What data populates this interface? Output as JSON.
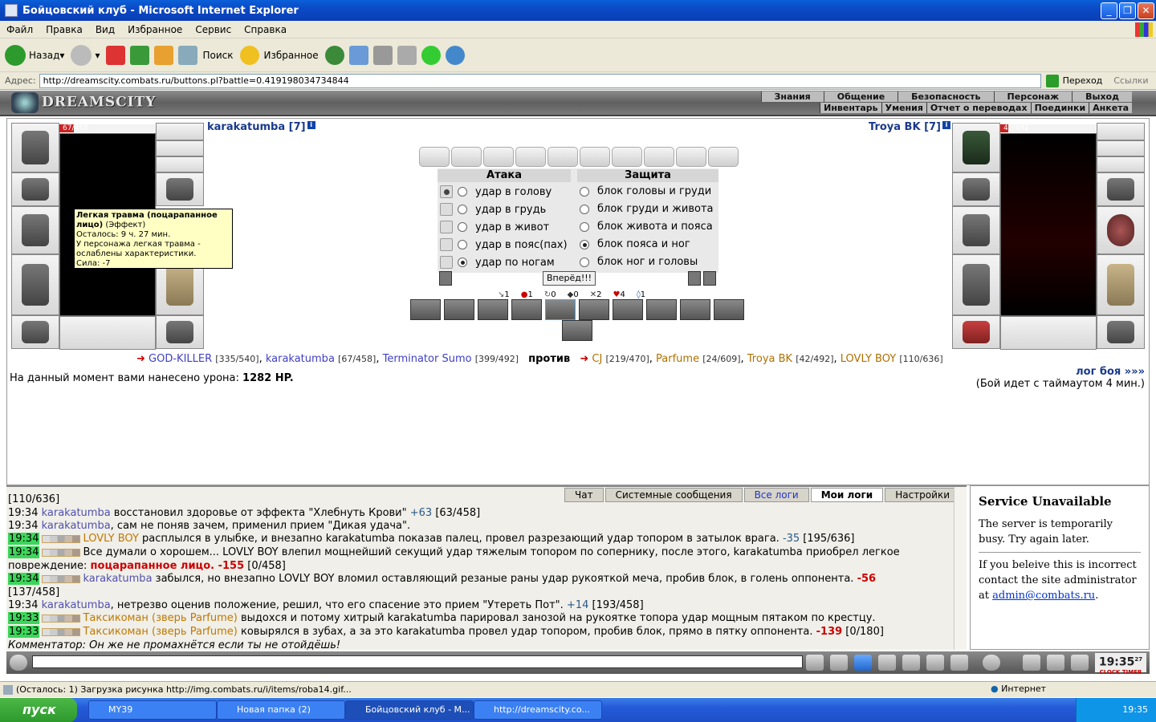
{
  "window": {
    "title": "Бойцовский клуб - Microsoft Internet Explorer"
  },
  "menu": [
    "Файл",
    "Правка",
    "Вид",
    "Избранное",
    "Сервис",
    "Справка"
  ],
  "toolbar": {
    "back": "Назад",
    "search": "Поиск",
    "favorites": "Избранное"
  },
  "address": {
    "label": "Адрес:",
    "url": "http://dreamscity.combats.ru/buttons.pl?battle=0.419198034734844",
    "go": "Переход",
    "links": "Ссылки"
  },
  "site": {
    "logo": "DREAMSCITY",
    "nav_top": [
      "Знания",
      "Общение",
      "Безопасность",
      "Персонаж",
      "Выход"
    ],
    "nav_bottom": [
      "Инвентарь",
      "Умения",
      "Отчет о переводах",
      "Поединки",
      "Анкета"
    ]
  },
  "player_left": {
    "name": "karakatumba [7]",
    "hp": "67/458",
    "hp_fraction": 0.146
  },
  "player_right": {
    "name": "Troya BK [7]",
    "hp": "42/492",
    "hp_fraction": 0.085
  },
  "tooltip": {
    "title": "Легкая травма (поцарапанное лицо)",
    "kind": "(Эффект)",
    "line1": "Осталось: 9 ч. 27 мин.",
    "line2": "У персонажа легкая травма - ослаблены характеристики.",
    "line3": "Сила: -7"
  },
  "attack": {
    "header": "Атака",
    "options": [
      "удар в голову",
      "удар в грудь",
      "удар в живот",
      "удар в пояс(пах)",
      "удар по ногам"
    ]
  },
  "defense": {
    "header": "Защита",
    "options": [
      "блок головы и груди",
      "блок груди и живота",
      "блок живота и пояса",
      "блок пояса и ног",
      "блок ног и головы"
    ]
  },
  "go_button": "Вперёд!!!",
  "stats": [
    "1",
    "1",
    "0",
    "0",
    "2",
    "4",
    "1"
  ],
  "teams": {
    "left": [
      {
        "name": "GOD-KILLER",
        "hp": "[335/540]"
      },
      {
        "name": "karakatumba",
        "hp": "[67/458]"
      },
      {
        "name": "Terminator Sumo",
        "hp": "[399/492]"
      }
    ],
    "vs": "против",
    "right": [
      {
        "name": "CJ",
        "hp": "[219/470]"
      },
      {
        "name": "Parfume",
        "hp": "[24/609]"
      },
      {
        "name": "Troya BK",
        "hp": "[42/492]"
      },
      {
        "name": "LOVLY BOY",
        "hp": "[110/636]"
      }
    ]
  },
  "damage": {
    "label": "На данный момент вами нанесено урона:",
    "value": "1282 HP."
  },
  "battle_log": {
    "link": "лог боя »»»",
    "timeout": "(Бой идет с таймаутом 4 мин.)"
  },
  "chat_tabs": [
    "Чат",
    "Системные сообщения",
    "Все логи",
    "Мои логи",
    "Настройки"
  ],
  "chat": [
    {
      "time": "",
      "text": "[110/636]"
    },
    {
      "time": "19:34",
      "who": "karakatumba",
      "text": " восстановил здоровье от эффекта \"Хлебнуть Крови\" ",
      "val": "+63",
      "tail": " [63/458]"
    },
    {
      "time": "19:34",
      "who": "karakatumba",
      "text": ", сам не поняв зачем, применил прием \"Дикая удача\"."
    },
    {
      "time": "19:34",
      "who": "LOVLY BOY",
      "text": " расплылся в улыбке, и внезапно karakatumba показав палец, провел разрезающий удар топором в затылок врага. ",
      "val": "-35",
      "tail": " [195/636]"
    },
    {
      "time": "19:34",
      "text": "Все думали о хорошем... LOVLY BOY влепил мощнейший секущий удар тяжелым топором по сопернику, после этого, karakatumba приобрел легкое"
    },
    {
      "time": "",
      "text": "повреждение: ",
      "val": "поцарапанное лицо. -155",
      "tail": " [0/458]"
    },
    {
      "time": "19:34",
      "who": "karakatumba",
      "text": " забылся, но внезапно LOVLY BOY вломил оставляющий резаные раны удар рукояткой меча, пробив блок, в голень оппонента. ",
      "val": "-56"
    },
    {
      "time": "",
      "text": "[137/458]"
    },
    {
      "time": "19:34",
      "who": "karakatumba",
      "text": ", нетрезво оценив положение, решил, что его спасение это прием \"Утереть Пот\". ",
      "val": "+14",
      "tail": " [193/458]"
    },
    {
      "time": "19:33",
      "who": "Таксикоман (зверь Parfume)",
      "text": " выдохся и потому хитрый karakatumba парировал занозой на рукоятке топора удар мощным пятаком по крестцу."
    },
    {
      "time": "19:33",
      "who": "Таксикоман (зверь Parfume)",
      "text": " ковырялся в зубах, а за это karakatumba провел удар топором, пробив блок, прямо в пятку оппонента. ",
      "val": "-139",
      "tail": " [0/180]"
    },
    {
      "time": "",
      "text": "Комментатор: Он же не промахнётся если ты не отойдёшь!"
    }
  ],
  "service": {
    "title": "Service Unavailable",
    "p1": "The server is temporarily busy. Try again later.",
    "p2": "If you beleive this is incorrect contact the site administrator at",
    "email": "admin@combats.ru",
    "dot": "."
  },
  "clock": {
    "time": "19:35",
    "sec": "27",
    "label1": "CLOCK",
    "label2": "TIMER"
  },
  "status": {
    "text": "(Осталось: 1) Загрузка рисунка http://img.combats.ru/i/items/roba14.gif...",
    "zone": "Интернет"
  },
  "taskbar": {
    "start": "пуск",
    "tasks": [
      "MY39",
      "Новая папка (2)",
      "Бойцовский клуб - M...",
      "http://dreamscity.co..."
    ],
    "time": "19:35"
  }
}
